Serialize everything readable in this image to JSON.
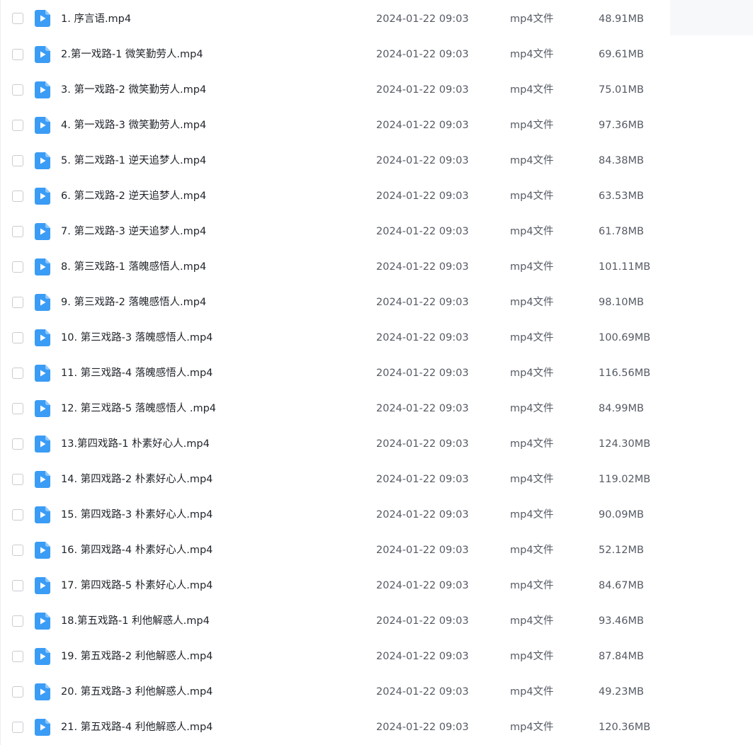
{
  "colors": {
    "icon_blue": "#3b9cf5",
    "icon_fold": "#8cc8ff",
    "text_primary": "#1f2329",
    "text_secondary": "#555a63"
  },
  "icons": {
    "file": "video-file-icon",
    "checkbox": "checkbox-icon"
  },
  "files": [
    {
      "name": "1. 序言语.mp4",
      "date": "2024-01-22 09:03",
      "type": "mp4文件",
      "size": "48.91MB"
    },
    {
      "name": "2.第一戏路-1 微笑勤劳人.mp4",
      "date": "2024-01-22 09:03",
      "type": "mp4文件",
      "size": "69.61MB"
    },
    {
      "name": "3. 第一戏路-2 微笑勤劳人.mp4",
      "date": "2024-01-22 09:03",
      "type": "mp4文件",
      "size": "75.01MB"
    },
    {
      "name": "4. 第一戏路-3 微笑勤劳人.mp4",
      "date": "2024-01-22 09:03",
      "type": "mp4文件",
      "size": "97.36MB"
    },
    {
      "name": "5. 第二戏路-1 逆天追梦人.mp4",
      "date": "2024-01-22 09:03",
      "type": "mp4文件",
      "size": "84.38MB"
    },
    {
      "name": "6. 第二戏路-2 逆天追梦人.mp4",
      "date": "2024-01-22 09:03",
      "type": "mp4文件",
      "size": "63.53MB"
    },
    {
      "name": "7. 第二戏路-3 逆天追梦人.mp4",
      "date": "2024-01-22 09:03",
      "type": "mp4文件",
      "size": "61.78MB"
    },
    {
      "name": "8. 第三戏路-1 落魄感悟人.mp4",
      "date": "2024-01-22 09:03",
      "type": "mp4文件",
      "size": "101.11MB"
    },
    {
      "name": "9. 第三戏路-2 落魄感悟人.mp4",
      "date": "2024-01-22 09:03",
      "type": "mp4文件",
      "size": "98.10MB"
    },
    {
      "name": "10. 第三戏路-3 落魄感悟人.mp4",
      "date": "2024-01-22 09:03",
      "type": "mp4文件",
      "size": "100.69MB"
    },
    {
      "name": "11. 第三戏路-4 落魄感悟人.mp4",
      "date": "2024-01-22 09:03",
      "type": "mp4文件",
      "size": "116.56MB"
    },
    {
      "name": "12. 第三戏路-5 落魄感悟人 .mp4",
      "date": "2024-01-22 09:03",
      "type": "mp4文件",
      "size": "84.99MB"
    },
    {
      "name": "13.第四戏路-1 朴素好心人.mp4",
      "date": "2024-01-22 09:03",
      "type": "mp4文件",
      "size": "124.30MB"
    },
    {
      "name": "14. 第四戏路-2 朴素好心人.mp4",
      "date": "2024-01-22 09:03",
      "type": "mp4文件",
      "size": "119.02MB"
    },
    {
      "name": "15. 第四戏路-3 朴素好心人.mp4",
      "date": "2024-01-22 09:03",
      "type": "mp4文件",
      "size": "90.09MB"
    },
    {
      "name": "16. 第四戏路-4 朴素好心人.mp4",
      "date": "2024-01-22 09:03",
      "type": "mp4文件",
      "size": "52.12MB"
    },
    {
      "name": "17. 第四戏路-5 朴素好心人.mp4",
      "date": "2024-01-22 09:03",
      "type": "mp4文件",
      "size": "84.67MB"
    },
    {
      "name": "18.第五戏路-1 利他解惑人.mp4",
      "date": "2024-01-22 09:03",
      "type": "mp4文件",
      "size": "93.46MB"
    },
    {
      "name": "19. 第五戏路-2 利他解惑人.mp4",
      "date": "2024-01-22 09:03",
      "type": "mp4文件",
      "size": "87.84MB"
    },
    {
      "name": "20. 第五戏路-3 利他解惑人.mp4",
      "date": "2024-01-22 09:03",
      "type": "mp4文件",
      "size": "49.23MB"
    },
    {
      "name": "21. 第五戏路-4 利他解惑人.mp4",
      "date": "2024-01-22 09:03",
      "type": "mp4文件",
      "size": "120.36MB"
    }
  ]
}
